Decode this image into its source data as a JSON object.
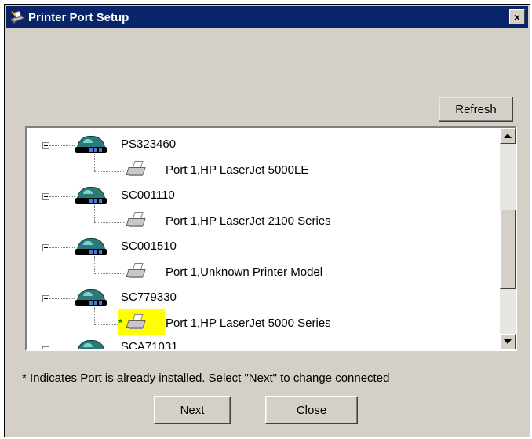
{
  "window": {
    "title": "Printer Port Setup",
    "close_label": "×"
  },
  "buttons": {
    "refresh": "Refresh",
    "next": "Next",
    "close": "Close"
  },
  "tree": {
    "items": [
      {
        "device": "PS323460",
        "port": "Port 1,HP LaserJet 5000LE",
        "installed": false
      },
      {
        "device": "SC001110",
        "port": "Port 1,HP LaserJet 2100 Series",
        "installed": false
      },
      {
        "device": "SC001510",
        "port": "Port 1,Unknown Printer Model",
        "installed": false
      },
      {
        "device": "SC779330",
        "port": "Port 1,HP LaserJet 5000 Series",
        "installed": true
      },
      {
        "device": "SCA71031",
        "port": null,
        "installed": false
      }
    ],
    "installed_marker": "*"
  },
  "note": "* Indicates Port is already installed. Select \"Next\" to change connected",
  "icons": {
    "title": "printer-setup-icon",
    "device": "print-server-icon",
    "port": "printer-icon",
    "scroll_up": "scroll-up-arrow-icon",
    "scroll_down": "scroll-down-arrow-icon"
  },
  "colors": {
    "titlebar": "#0a246a",
    "highlight": "#ffff00",
    "dialog": "#d4d0c8"
  }
}
